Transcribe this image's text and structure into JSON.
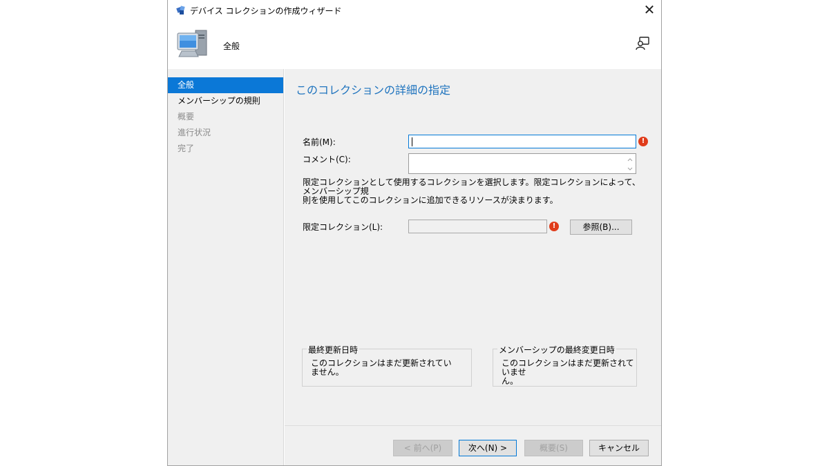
{
  "window": {
    "title": "デバイス コレクションの作成ウィザード",
    "close_glyph": "✕"
  },
  "header": {
    "title": "全般"
  },
  "nav": {
    "items": [
      {
        "label": "全般",
        "state": "active"
      },
      {
        "label": "メンバーシップの規則",
        "state": "normal"
      },
      {
        "label": "概要",
        "state": "disabled"
      },
      {
        "label": "進行状況",
        "state": "disabled"
      },
      {
        "label": "完了",
        "state": "disabled"
      }
    ]
  },
  "main": {
    "heading": "このコレクションの詳細の指定",
    "name_label": "名前(M):",
    "name_value": "",
    "comment_label": "コメント(C):",
    "comment_value": "",
    "description_line1": "限定コレクションとして使用するコレクションを選択します。限定コレクションによって、メンバーシップ規",
    "description_line2": "則を使用してこのコレクションに追加できるリソースが決まります。",
    "limit_label": "限定コレクション(L):",
    "limit_value": "",
    "browse_label": "参照(B)...",
    "error_glyph": "!",
    "last_update_title": "最終更新日時",
    "last_update_line1": "このコレクションはまだ更新されてい",
    "last_update_line2": "ません。",
    "membership_change_title": "メンバーシップの最終変更日時",
    "membership_change_line1": "このコレクションはまだ更新されていませ",
    "membership_change_line2": "ん。"
  },
  "footer": {
    "prev_label": "< 前へ(P)",
    "next_label": "次へ(N) >",
    "summary_label": "概要(S)",
    "cancel_label": "キャンセル"
  },
  "colors": {
    "accent": "#0b78d7",
    "heading": "#1e73be",
    "error": "#e03c1b",
    "panel": "#f0f0f0"
  },
  "icons": {
    "title": "sccm-app-icon",
    "header": "computer-icon",
    "help": "help-person-icon",
    "error": "error-icon"
  }
}
